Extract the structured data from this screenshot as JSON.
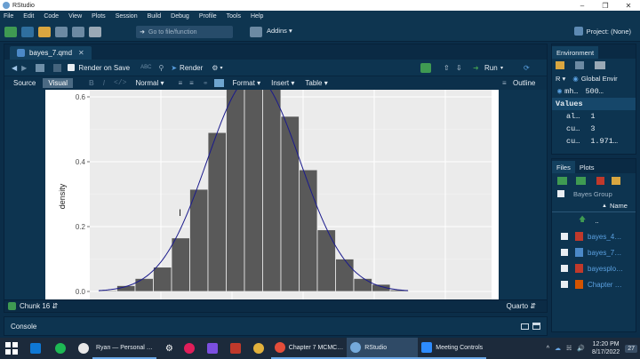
{
  "window": {
    "title": "RStudio"
  },
  "menu": [
    "File",
    "Edit",
    "Code",
    "View",
    "Plots",
    "Session",
    "Build",
    "Debug",
    "Profile",
    "Tools",
    "Help"
  ],
  "toolbar": {
    "goto_placeholder": "Go to file/function",
    "addins": "Addins",
    "project": "Project: (None)"
  },
  "editor": {
    "tab_label": "bayes_7.qmd",
    "render_on_save": "Render on Save",
    "render": "Render",
    "run": "Run",
    "source": "Source",
    "visual": "Visual",
    "format_normal": "Normal",
    "format": "Format",
    "insert": "Insert",
    "table": "Table",
    "outline": "Outline",
    "chunk": "Chunk 16",
    "doc_type": "Quarto"
  },
  "console": {
    "label": "Console"
  },
  "environment": {
    "tab": "Environment",
    "lang": "R",
    "scope": "Global Envir",
    "data_row": {
      "name": "mh…",
      "value": "500…"
    },
    "values_header": "Values",
    "values": [
      {
        "name": "al…",
        "value": "1"
      },
      {
        "name": "cu…",
        "value": "3"
      },
      {
        "name": "cu…",
        "value": "1.971…"
      }
    ]
  },
  "files": {
    "tabs": [
      "Files",
      "Plots"
    ],
    "path": "Bayes Group",
    "col_name": "Name",
    "up": "..",
    "items": [
      {
        "name": "bayes_4…",
        "color": "#c0392b"
      },
      {
        "name": "bayes_7…",
        "color": "#4b89c8"
      },
      {
        "name": "bayesplo…",
        "color": "#c0392b"
      },
      {
        "name": "Chapter …",
        "color": "#d35400"
      }
    ]
  },
  "taskbar": {
    "items": [
      "Ryan — Personal …",
      "Chapter 7 MCMC…",
      "RStudio",
      "Meeting Controls"
    ],
    "time": "12:20 PM",
    "date": "8/17/2022",
    "badge": "27"
  },
  "chart_data": {
    "type": "bar",
    "ylabel": "density",
    "ylim": [
      0,
      0.6
    ],
    "y_ticks": [
      "0.0",
      "0.2",
      "0.4",
      "0.6"
    ],
    "bins": [
      0.003,
      0.018,
      0.04,
      0.075,
      0.165,
      0.315,
      0.49,
      0.625,
      0.66,
      0.64,
      0.54,
      0.375,
      0.19,
      0.1,
      0.04,
      0.022,
      0.005
    ],
    "curve": "normal density overlay"
  }
}
